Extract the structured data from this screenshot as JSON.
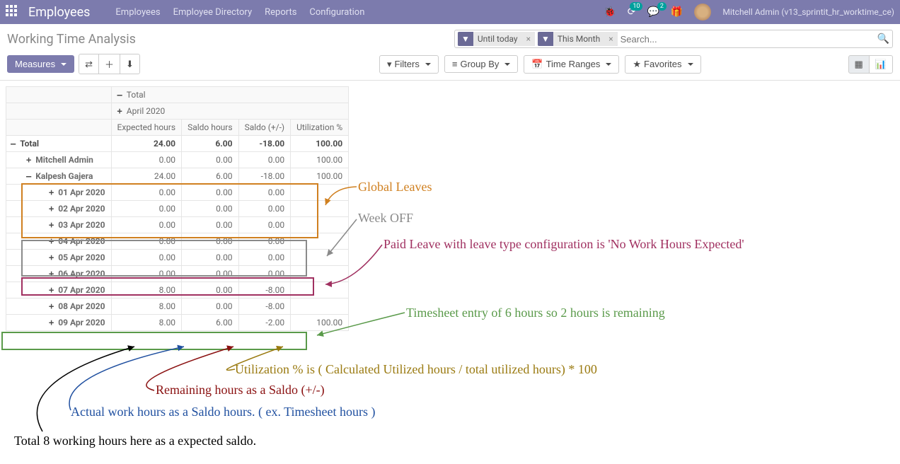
{
  "navbar": {
    "brand": "Employees",
    "links": [
      "Employees",
      "Employee Directory",
      "Reports",
      "Configuration"
    ],
    "badges": {
      "activity": "10",
      "messages": "2"
    },
    "username": "Mitchell Admin (v13_sprintit_hr_worktime_ce)"
  },
  "cp": {
    "title": "Working Time Analysis",
    "facets": [
      {
        "label": "Until today"
      },
      {
        "label": "This Month"
      }
    ],
    "search_placeholder": "Search...",
    "measures": "Measures",
    "filters": "Filters",
    "groupby": "Group By",
    "timeranges": "Time Ranges",
    "favorites": "Favorites"
  },
  "pivot": {
    "top_header": "Total",
    "month_header": "April 2020",
    "cols": [
      "Expected hours",
      "Saldo hours",
      "Saldo (+/-)",
      "Utilization %"
    ],
    "rows": [
      {
        "label": "Total",
        "indent": 0,
        "pm": "—",
        "bold": true,
        "vals": [
          "24.00",
          "6.00",
          "-18.00",
          "100.00"
        ]
      },
      {
        "label": "Mitchell Admin",
        "indent": 1,
        "pm": "+",
        "vals": [
          "0.00",
          "0.00",
          "0.00",
          "100.00"
        ]
      },
      {
        "label": "Kalpesh Gajera",
        "indent": 1,
        "pm": "—",
        "vals": [
          "24.00",
          "6.00",
          "-18.00",
          "100.00"
        ]
      },
      {
        "label": "01 Apr 2020",
        "indent": 3,
        "pm": "+",
        "vals": [
          "0.00",
          "0.00",
          "0.00",
          ""
        ]
      },
      {
        "label": "02 Apr 2020",
        "indent": 3,
        "pm": "+",
        "vals": [
          "0.00",
          "0.00",
          "0.00",
          ""
        ]
      },
      {
        "label": "03 Apr 2020",
        "indent": 3,
        "pm": "+",
        "vals": [
          "0.00",
          "0.00",
          "0.00",
          ""
        ]
      },
      {
        "label": "04 Apr 2020",
        "indent": 3,
        "pm": "+",
        "vals": [
          "0.00",
          "0.00",
          "0.00",
          ""
        ]
      },
      {
        "label": "05 Apr 2020",
        "indent": 3,
        "pm": "+",
        "vals": [
          "0.00",
          "0.00",
          "0.00",
          ""
        ]
      },
      {
        "label": "06 Apr 2020",
        "indent": 3,
        "pm": "+",
        "vals": [
          "0.00",
          "0.00",
          "0.00",
          ""
        ]
      },
      {
        "label": "07 Apr 2020",
        "indent": 3,
        "pm": "+",
        "vals": [
          "8.00",
          "0.00",
          "-8.00",
          ""
        ]
      },
      {
        "label": "08 Apr 2020",
        "indent": 3,
        "pm": "+",
        "vals": [
          "8.00",
          "0.00",
          "-8.00",
          ""
        ]
      },
      {
        "label": "09 Apr 2020",
        "indent": 3,
        "pm": "+",
        "vals": [
          "8.00",
          "6.00",
          "-2.00",
          "100.00"
        ]
      }
    ]
  },
  "annotations": {
    "global_leaves": "Global Leaves",
    "week_off": "Week OFF",
    "paid_leave": "Paid Leave with leave type configuration is 'No Work Hours Expected'",
    "timesheet": "Timesheet entry of 6 hours so 2 hours is remaining",
    "utilization": "Utilization % is ( Calculated Utilized hours / total utilized hours) * 100",
    "remaining": "Remaining hours as a Saldo (+/-)",
    "actual": "Actual work hours as a Saldo hours. ( ex. Timesheet hours )",
    "expected": "Total 8 working hours here as a expected saldo."
  },
  "colors": {
    "orange": "#d08020",
    "gray": "#8a8a8a",
    "maroon": "#a03060",
    "green": "#5a9a4a"
  }
}
